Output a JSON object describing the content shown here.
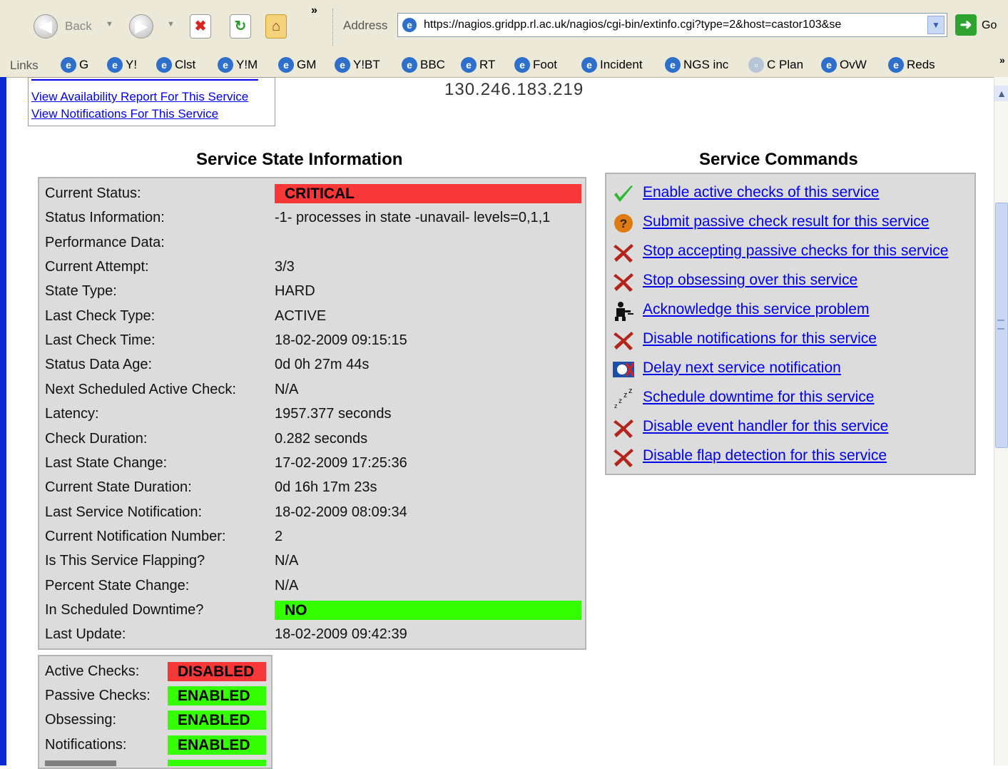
{
  "toolbar": {
    "back_label": "Back",
    "chevron": "»",
    "address_label": "Address",
    "url": "https://nagios.gridpp.rl.ac.uk/nagios/cgi-bin/extinfo.cgi?type=2&host=castor103&se",
    "go_label": "Go"
  },
  "linksbar": {
    "label": "Links",
    "items": [
      "G",
      "Y!",
      "Clst",
      "Y!M",
      "GM",
      "Y!BT",
      "BBC",
      "RT",
      "Foot",
      "Incident",
      "NGS inc",
      "C Plan",
      "OvW",
      "Reds"
    ],
    "chevron": "»"
  },
  "service_links": {
    "availability": "View Availability Report For This Service",
    "notifications": "View Notifications For This Service"
  },
  "host_ip": "130.246.183.219",
  "state_info": {
    "title": "Service State Information",
    "rows": [
      {
        "label": "Current Status:",
        "value": "CRITICAL"
      },
      {
        "label": "Status Information:",
        "value": "-1- processes in state -unavail- levels=0,1,1"
      },
      {
        "label": "Performance Data:",
        "value": ""
      },
      {
        "label": "Current Attempt:",
        "value": "3/3"
      },
      {
        "label": "State Type:",
        "value": "HARD"
      },
      {
        "label": "Last Check Type:",
        "value": "ACTIVE"
      },
      {
        "label": "Last Check Time:",
        "value": "18-02-2009 09:15:15"
      },
      {
        "label": "Status Data Age:",
        "value": "0d 0h 27m 44s"
      },
      {
        "label": "Next Scheduled Active Check:",
        "value": "N/A"
      },
      {
        "label": "Latency:",
        "value": "1957.377 seconds"
      },
      {
        "label": "Check Duration:",
        "value": "0.282 seconds"
      },
      {
        "label": "Last State Change:",
        "value": "17-02-2009 17:25:36"
      },
      {
        "label": "Current State Duration:",
        "value": "0d 16h 17m 23s"
      },
      {
        "label": "Last Service Notification:",
        "value": "18-02-2009 08:09:34"
      },
      {
        "label": "Current Notification Number:",
        "value": "2"
      },
      {
        "label": "Is This Service Flapping?",
        "value": "N/A"
      },
      {
        "label": "Percent State Change:",
        "value": "N/A"
      },
      {
        "label": "In Scheduled Downtime?",
        "value": "NO"
      },
      {
        "label": "Last Update:",
        "value": "18-02-2009 09:42:39"
      }
    ]
  },
  "checks": [
    {
      "label": "Active Checks:",
      "value": "DISABLED",
      "color": "#f83838"
    },
    {
      "label": "Passive Checks:",
      "value": "ENABLED",
      "color": "#33ff00"
    },
    {
      "label": "Obsessing:",
      "value": "ENABLED",
      "color": "#33ff00"
    },
    {
      "label": "Notifications:",
      "value": "ENABLED",
      "color": "#33ff00"
    }
  ],
  "commands": {
    "title": "Service Commands",
    "items": [
      {
        "label": "Enable active checks of this service",
        "icon": "checkmark-icon"
      },
      {
        "label": "Submit passive check result for this service",
        "icon": "question-icon"
      },
      {
        "label": "Stop accepting passive checks for this service",
        "icon": "x-icon"
      },
      {
        "label": "Stop obsessing over this service",
        "icon": "x-icon"
      },
      {
        "label": "Acknowledge this service problem",
        "icon": "acknowledge-icon"
      },
      {
        "label": "Disable notifications for this service",
        "icon": "x-icon"
      },
      {
        "label": "Delay next service notification",
        "icon": "delay-icon"
      },
      {
        "label": "Schedule downtime for this service",
        "icon": "zzz-icon"
      },
      {
        "label": "Disable event handler for this service",
        "icon": "x-icon"
      },
      {
        "label": "Disable flap detection for this service",
        "icon": "x-icon"
      }
    ]
  },
  "colors": {
    "critical": "#f83838",
    "ok": "#33ff00",
    "panel": "#dcdcdc",
    "link": "#0000ee"
  }
}
